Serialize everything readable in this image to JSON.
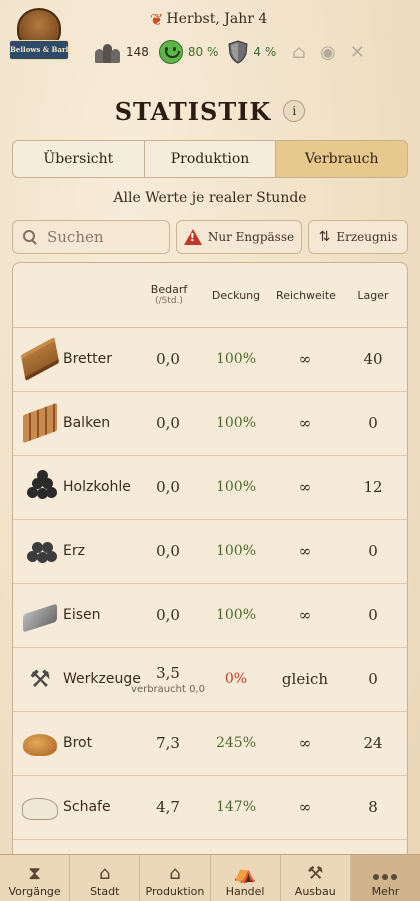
{
  "header": {
    "logo_text": "Bellows & Barley",
    "season": "Herbst, Jahr 4",
    "population": "148",
    "happiness": "80 %",
    "defense": "4 %"
  },
  "page": {
    "title": "STATISTIK",
    "info": "i",
    "subtitle": "Alle Werte je realer Stunde"
  },
  "tabs": [
    "Übersicht",
    "Produktion",
    "Verbrauch"
  ],
  "active_tab": "Verbrauch",
  "filters": {
    "search_placeholder": "Suchen",
    "shortage_label": "Nur Engpässe",
    "sort_label": "Erzeugnis"
  },
  "table": {
    "headers": {
      "demand": "Bedarf",
      "demand_unit": "(/Std.)",
      "coverage": "Deckung",
      "reach": "Reichweite",
      "stock": "Lager"
    },
    "rows": [
      {
        "icon": "planks-icon",
        "name": "Bretter",
        "demand": "0,0",
        "coverage": "100%",
        "reach": "∞",
        "stock": "40"
      },
      {
        "icon": "beams-icon",
        "name": "Balken",
        "demand": "0,0",
        "coverage": "100%",
        "reach": "∞",
        "stock": "0"
      },
      {
        "icon": "charcoal-icon",
        "name": "Holzkohle",
        "demand": "0,0",
        "coverage": "100%",
        "reach": "∞",
        "stock": "12"
      },
      {
        "icon": "ore-icon",
        "name": "Erz",
        "demand": "0,0",
        "coverage": "100%",
        "reach": "∞",
        "stock": "0"
      },
      {
        "icon": "iron-icon",
        "name": "Eisen",
        "demand": "0,0",
        "coverage": "100%",
        "reach": "∞",
        "stock": "0"
      },
      {
        "icon": "tools-icon",
        "name": "Werkzeuge",
        "demand": "3,5",
        "demand_note": "verbraucht 0,0",
        "coverage": "0%",
        "coverage_status": "red",
        "reach": "gleich",
        "stock": "0"
      },
      {
        "icon": "bread-icon",
        "name": "Brot",
        "demand": "7,3",
        "coverage": "245%",
        "reach": "∞",
        "stock": "24"
      },
      {
        "icon": "sheep-icon",
        "name": "Schafe",
        "demand": "4,7",
        "coverage": "147%",
        "reach": "∞",
        "stock": "8"
      }
    ]
  },
  "nav": [
    "Vorgänge",
    "Stadt",
    "Produktion",
    "Handel",
    "Ausbau",
    "Mehr"
  ],
  "active_nav": "Mehr",
  "colors": {
    "active_tab": "#e7c98d",
    "coverage_ok": "#4b6b2c",
    "coverage_bad": "#c53b28"
  }
}
